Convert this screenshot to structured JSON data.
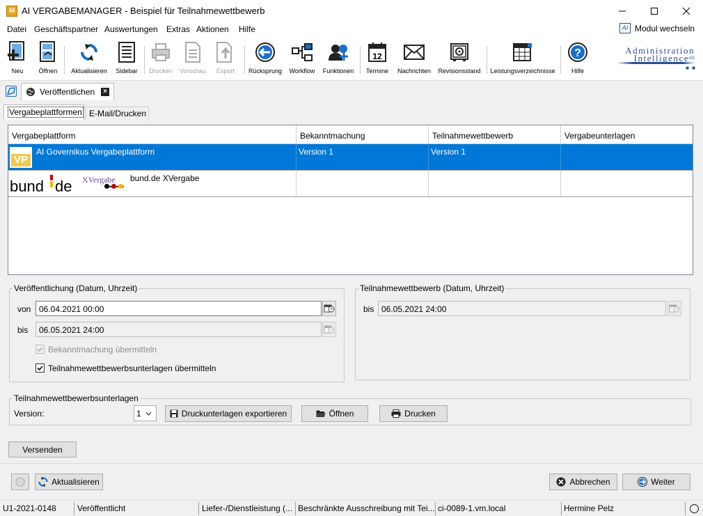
{
  "window": {
    "title": "AI VERGABEMANAGER - Beispiel für Teilnahmewettbewerb",
    "app_icon_text": "M",
    "controls": {
      "minimize": "—",
      "maximize": "☐",
      "close": "✕"
    }
  },
  "menu": {
    "items": [
      "Datei",
      "Geschäftspartner",
      "Auswertungen",
      "Extras",
      "Aktionen",
      "Hilfe"
    ],
    "module_switch": "Modul wechseln",
    "module_icon_text": "AI"
  },
  "toolbar": {
    "buttons": [
      {
        "label": "Neu",
        "icon": "new-document-icon",
        "enabled": true
      },
      {
        "label": "Öffnen",
        "icon": "open-icon",
        "enabled": true
      },
      {
        "label": "Aktualisieren",
        "icon": "refresh-icon",
        "enabled": true
      },
      {
        "label": "Sidebar",
        "icon": "sidebar-icon",
        "enabled": true
      },
      {
        "label": "Drucken",
        "icon": "printer-icon",
        "enabled": false
      },
      {
        "label": "Vorschau",
        "icon": "preview-icon",
        "enabled": false
      },
      {
        "label": "Export",
        "icon": "export-icon",
        "enabled": false
      },
      {
        "label": "Rücksprung",
        "icon": "back-arrow-icon",
        "enabled": true
      },
      {
        "label": "Workflow",
        "icon": "workflow-icon",
        "enabled": true
      },
      {
        "label": "Funktionen",
        "icon": "functions-icon",
        "enabled": true
      },
      {
        "label": "Termine",
        "icon": "calendar-icon",
        "enabled": true
      },
      {
        "label": "Nachrichten",
        "icon": "envelope-icon",
        "enabled": true
      },
      {
        "label": "Revisionsstand",
        "icon": "safe-icon",
        "enabled": true
      },
      {
        "label": "Leistungsverzeichnisse",
        "icon": "table-icon",
        "enabled": true
      },
      {
        "label": "Hilfe",
        "icon": "help-icon",
        "enabled": true
      }
    ],
    "calendar_day": "12",
    "logo": {
      "line1": "Administration",
      "line2": "Intelligence",
      "suffix": "AG"
    }
  },
  "doc_tab": {
    "label": "Veröffentlichen"
  },
  "sub_tabs": [
    "Vergabeplattformen",
    "E-Mail/Drucken"
  ],
  "grid": {
    "columns": [
      "Vergabeplattform",
      "Bekanntmachung",
      "Teilnahmewettbewerb",
      "Vergabeunterlagen"
    ],
    "rows": [
      {
        "platform": "AI Governikus Vergabeplattform",
        "logo_text": "VP",
        "bekanntmachung": "Version 1",
        "teilnahmewettbewerb": "Version 1",
        "vergabeunterlagen": "",
        "selected": true
      },
      {
        "platform": "bund.de XVergabe",
        "logo_text_1": "bund",
        "logo_text_2": "de",
        "logo_text_3": "XVergabe",
        "bekanntmachung": "",
        "teilnahmewettbewerb": "",
        "vergabeunterlagen": "",
        "selected": false
      }
    ]
  },
  "veroeffentlichung": {
    "legend": "Veröffentlichung (Datum, Uhrzeit)",
    "von_label": "von",
    "von_value": "06.04.2021 00:00",
    "bis_label": "bis",
    "bis_value": "06.05.2021 24:00",
    "chk_bekanntmachung": "Bekanntmachung übermitteln",
    "chk_teilnahme": "Teilnahmewettbewerbsunterlagen übermitteln"
  },
  "teilnahmewettbewerb": {
    "legend": "Teilnahmewettbewerb (Datum, Uhrzeit)",
    "bis_label": "bis",
    "bis_value": "06.05.2021 24:00"
  },
  "unterlagen": {
    "legend": "Teilnahmewettbewerbsunterlagen",
    "version_label": "Version:",
    "version_value": "1",
    "btn_export": "Druckunterlagen exportieren",
    "btn_open": "Öffnen",
    "btn_print": "Drucken"
  },
  "actions": {
    "send": "Versenden",
    "refresh": "Aktualisieren",
    "cancel": "Abbrechen",
    "next": "Weiter"
  },
  "statusbar": {
    "cells": [
      "U1-2021-0148",
      "Veröffentlicht",
      "Liefer-/Dienstleistung (...",
      "Beschränkte Ausschreibung mit Tei...",
      "ci-0089-1.vm.local",
      "Hermine Pelz"
    ]
  }
}
